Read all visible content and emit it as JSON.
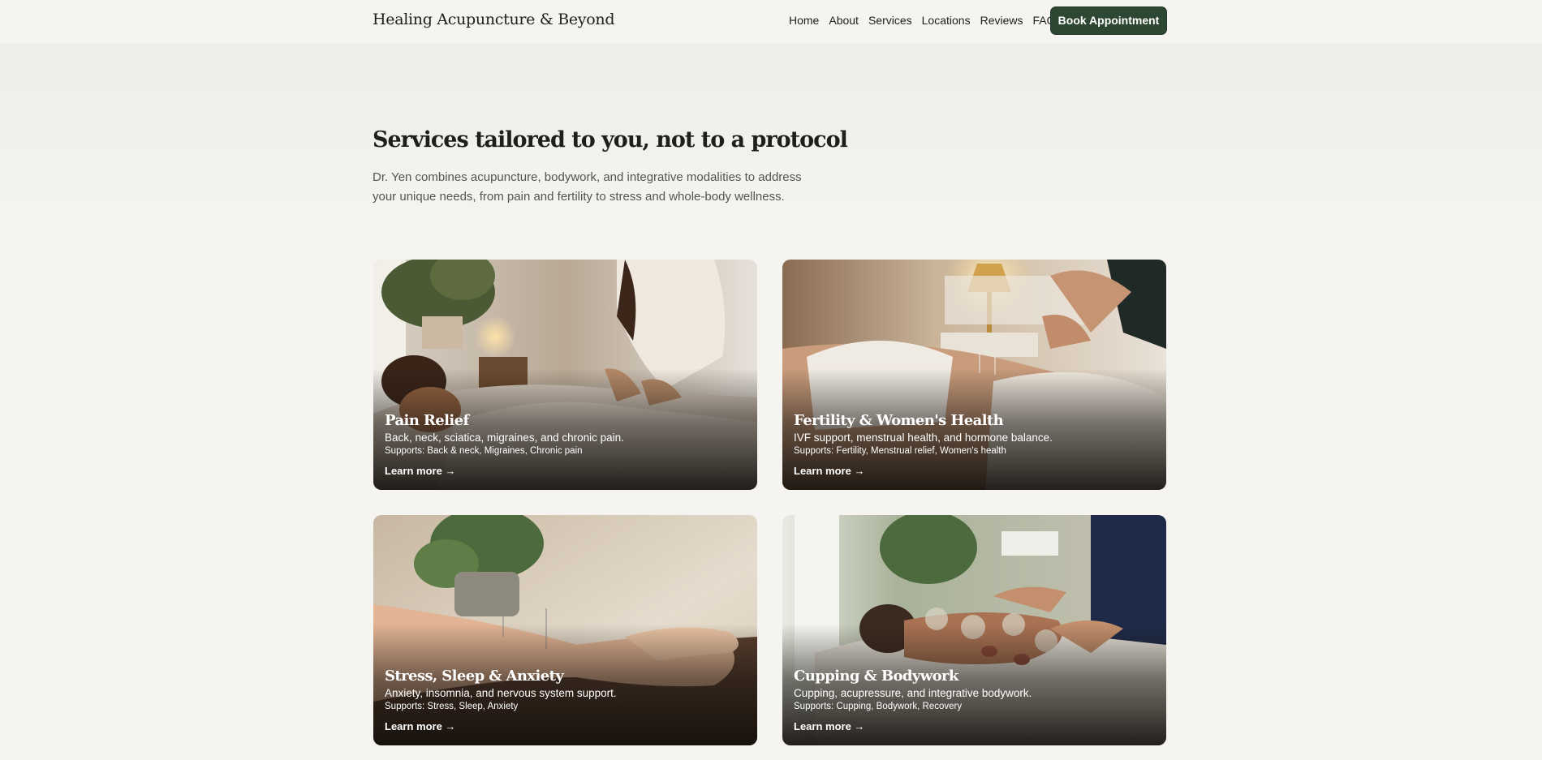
{
  "header": {
    "brand": "Healing Acupuncture & Beyond",
    "nav": [
      "Home",
      "About",
      "Services",
      "Locations",
      "Reviews",
      "FAQ"
    ],
    "cta": "Book Appointment"
  },
  "intro": {
    "title": "Services tailored to you, not to a protocol",
    "lede": "Dr. Yen combines acupuncture, bodywork, and integrative modalities to address your unique needs, from pain and fertility to stress and whole-body wellness."
  },
  "cards": [
    {
      "title": "Pain Relief",
      "desc": "Back, neck, sciatica, migraines, and chronic pain.",
      "supports": "Supports: Back & neck, Migraines, Chronic pain",
      "link": "Learn more →"
    },
    {
      "title": "Fertility & Women's Health",
      "desc": "IVF support, menstrual health, and hormone balance.",
      "supports": "Supports: Fertility, Menstrual relief, Women's health",
      "link": "Learn more →"
    },
    {
      "title": "Stress, Sleep & Anxiety",
      "desc": "Anxiety, insomnia, and nervous system support.",
      "supports": "Supports: Stress, Sleep, Anxiety",
      "link": "Learn more →"
    },
    {
      "title": "Cupping & Bodywork",
      "desc": "Cupping, acupressure, and integrative bodywork.",
      "supports": "Supports: Cupping, Bodywork, Recovery",
      "link": "Learn more →"
    }
  ],
  "colors": {
    "background": "#f5f4f0",
    "brand_green": "#2e4733",
    "text": "#1e1e1c",
    "muted_text": "#55544f"
  }
}
